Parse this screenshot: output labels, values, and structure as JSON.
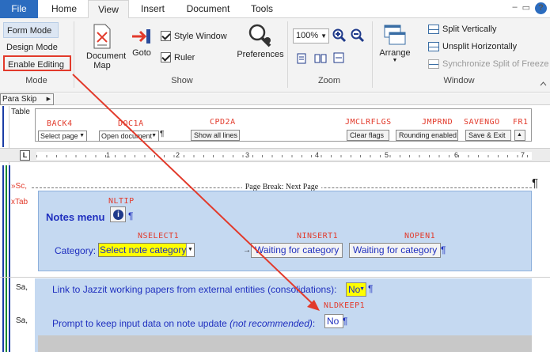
{
  "tabs": {
    "file": "File",
    "home": "Home",
    "view": "View",
    "insert": "Insert",
    "document": "Document",
    "tools": "Tools"
  },
  "window_icons": {
    "minimize": "–",
    "options": "▭",
    "help": "?"
  },
  "ribbon": {
    "mode": {
      "form_mode": "Form Mode",
      "design_mode": "Design Mode",
      "enable_editing": "Enable Editing",
      "group_label": "Mode"
    },
    "show": {
      "document_map": "Document Map",
      "goto": "Goto",
      "style_window": "Style Window",
      "ruler": "Ruler",
      "preferences": "Preferences",
      "group_label": "Show"
    },
    "zoom": {
      "value": "100%",
      "group_label": "Zoom"
    },
    "window": {
      "arrange": "Arrange",
      "split_vertically": "Split Vertically",
      "unsplit_horizontally": "Unsplit Horizontally",
      "synchronize_split": "Synchronize Split of Freeze",
      "group_label": "Window"
    }
  },
  "paraskip": {
    "label": "Para Skip"
  },
  "document": {
    "margin_labels": {
      "table": "Table",
      "sc": "»Sc,",
      "tab": "xTab",
      "sa1": "Sa,",
      "sa2": "Sa,"
    },
    "toolbar": {
      "codes": {
        "back4": "BACK4",
        "doc1a": "DOC1A",
        "cpd2a": "CPD2A",
        "jmclrflgs": "JMCLRFLGS",
        "jmprnd": "JMPRND",
        "savengo": "SAVENGO",
        "fr1": "FR1"
      },
      "select_page": "Select page",
      "open_document": "Open document",
      "show_all_lines": "Show all lines",
      "clear_flags": "Clear flags",
      "rounding_enabled": "Rounding enabled",
      "save_exit": "Save & Exit",
      "up_arrow": "▲"
    },
    "ruler": {
      "l_marker": "L",
      "numbers": [
        "1",
        "2",
        "3",
        "4",
        "5",
        "6",
        "7"
      ]
    },
    "page_break": "Page Break: Next Page",
    "pilcrow": "¶",
    "notes": {
      "nltip_code": "NLTIP",
      "title": "Notes menu",
      "info_icon": "i",
      "nselect1_code": "NSELECT1",
      "category_label": "Category:",
      "category_value": "Select note category",
      "ninsert1_code": "NINSERT1",
      "ninsert1_value": "Waiting for category",
      "nopen1_code": "NOPEN1",
      "nopen1_value": "Waiting for category"
    },
    "questions": {
      "q1_text": "Link to Jazzit working papers from external entities (consolidations):",
      "q1_value": "No",
      "nldkeep1_code": "NLDKEEP1",
      "q2_text": "Prompt to keep input data on note update",
      "q2_note": "(not recommended)",
      "q2_colon": ":",
      "q2_value": "No"
    }
  },
  "annotation_color": "#e23a2b",
  "accent_color": "#2b6cbf",
  "text_blue": "#1f2fbf",
  "panel_bg": "#c5d9f1"
}
